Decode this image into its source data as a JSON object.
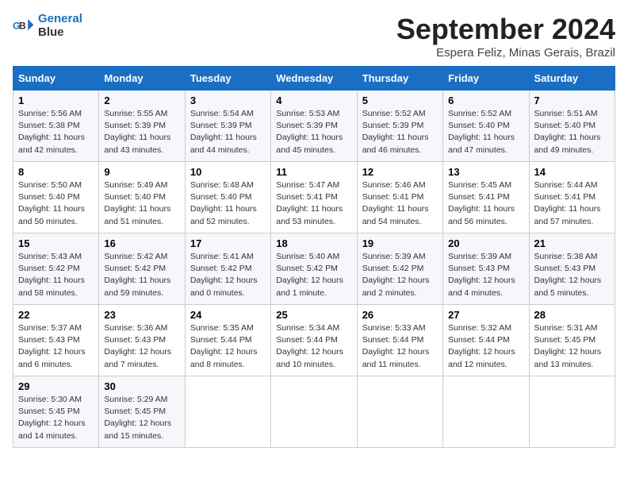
{
  "header": {
    "logo_line1": "General",
    "logo_line2": "Blue",
    "title": "September 2024",
    "subtitle": "Espera Feliz, Minas Gerais, Brazil"
  },
  "weekdays": [
    "Sunday",
    "Monday",
    "Tuesday",
    "Wednesday",
    "Thursday",
    "Friday",
    "Saturday"
  ],
  "weeks": [
    [
      {
        "day": "1",
        "sunrise": "5:56 AM",
        "sunset": "5:38 PM",
        "daylight": "11 hours and 42 minutes."
      },
      {
        "day": "2",
        "sunrise": "5:55 AM",
        "sunset": "5:39 PM",
        "daylight": "11 hours and 43 minutes."
      },
      {
        "day": "3",
        "sunrise": "5:54 AM",
        "sunset": "5:39 PM",
        "daylight": "11 hours and 44 minutes."
      },
      {
        "day": "4",
        "sunrise": "5:53 AM",
        "sunset": "5:39 PM",
        "daylight": "11 hours and 45 minutes."
      },
      {
        "day": "5",
        "sunrise": "5:52 AM",
        "sunset": "5:39 PM",
        "daylight": "11 hours and 46 minutes."
      },
      {
        "day": "6",
        "sunrise": "5:52 AM",
        "sunset": "5:40 PM",
        "daylight": "11 hours and 47 minutes."
      },
      {
        "day": "7",
        "sunrise": "5:51 AM",
        "sunset": "5:40 PM",
        "daylight": "11 hours and 49 minutes."
      }
    ],
    [
      {
        "day": "8",
        "sunrise": "5:50 AM",
        "sunset": "5:40 PM",
        "daylight": "11 hours and 50 minutes."
      },
      {
        "day": "9",
        "sunrise": "5:49 AM",
        "sunset": "5:40 PM",
        "daylight": "11 hours and 51 minutes."
      },
      {
        "day": "10",
        "sunrise": "5:48 AM",
        "sunset": "5:40 PM",
        "daylight": "11 hours and 52 minutes."
      },
      {
        "day": "11",
        "sunrise": "5:47 AM",
        "sunset": "5:41 PM",
        "daylight": "11 hours and 53 minutes."
      },
      {
        "day": "12",
        "sunrise": "5:46 AM",
        "sunset": "5:41 PM",
        "daylight": "11 hours and 54 minutes."
      },
      {
        "day": "13",
        "sunrise": "5:45 AM",
        "sunset": "5:41 PM",
        "daylight": "11 hours and 56 minutes."
      },
      {
        "day": "14",
        "sunrise": "5:44 AM",
        "sunset": "5:41 PM",
        "daylight": "11 hours and 57 minutes."
      }
    ],
    [
      {
        "day": "15",
        "sunrise": "5:43 AM",
        "sunset": "5:42 PM",
        "daylight": "11 hours and 58 minutes."
      },
      {
        "day": "16",
        "sunrise": "5:42 AM",
        "sunset": "5:42 PM",
        "daylight": "11 hours and 59 minutes."
      },
      {
        "day": "17",
        "sunrise": "5:41 AM",
        "sunset": "5:42 PM",
        "daylight": "12 hours and 0 minutes."
      },
      {
        "day": "18",
        "sunrise": "5:40 AM",
        "sunset": "5:42 PM",
        "daylight": "12 hours and 1 minute."
      },
      {
        "day": "19",
        "sunrise": "5:39 AM",
        "sunset": "5:42 PM",
        "daylight": "12 hours and 2 minutes."
      },
      {
        "day": "20",
        "sunrise": "5:39 AM",
        "sunset": "5:43 PM",
        "daylight": "12 hours and 4 minutes."
      },
      {
        "day": "21",
        "sunrise": "5:38 AM",
        "sunset": "5:43 PM",
        "daylight": "12 hours and 5 minutes."
      }
    ],
    [
      {
        "day": "22",
        "sunrise": "5:37 AM",
        "sunset": "5:43 PM",
        "daylight": "12 hours and 6 minutes."
      },
      {
        "day": "23",
        "sunrise": "5:36 AM",
        "sunset": "5:43 PM",
        "daylight": "12 hours and 7 minutes."
      },
      {
        "day": "24",
        "sunrise": "5:35 AM",
        "sunset": "5:44 PM",
        "daylight": "12 hours and 8 minutes."
      },
      {
        "day": "25",
        "sunrise": "5:34 AM",
        "sunset": "5:44 PM",
        "daylight": "12 hours and 10 minutes."
      },
      {
        "day": "26",
        "sunrise": "5:33 AM",
        "sunset": "5:44 PM",
        "daylight": "12 hours and 11 minutes."
      },
      {
        "day": "27",
        "sunrise": "5:32 AM",
        "sunset": "5:44 PM",
        "daylight": "12 hours and 12 minutes."
      },
      {
        "day": "28",
        "sunrise": "5:31 AM",
        "sunset": "5:45 PM",
        "daylight": "12 hours and 13 minutes."
      }
    ],
    [
      {
        "day": "29",
        "sunrise": "5:30 AM",
        "sunset": "5:45 PM",
        "daylight": "12 hours and 14 minutes."
      },
      {
        "day": "30",
        "sunrise": "5:29 AM",
        "sunset": "5:45 PM",
        "daylight": "12 hours and 15 minutes."
      },
      null,
      null,
      null,
      null,
      null
    ]
  ]
}
